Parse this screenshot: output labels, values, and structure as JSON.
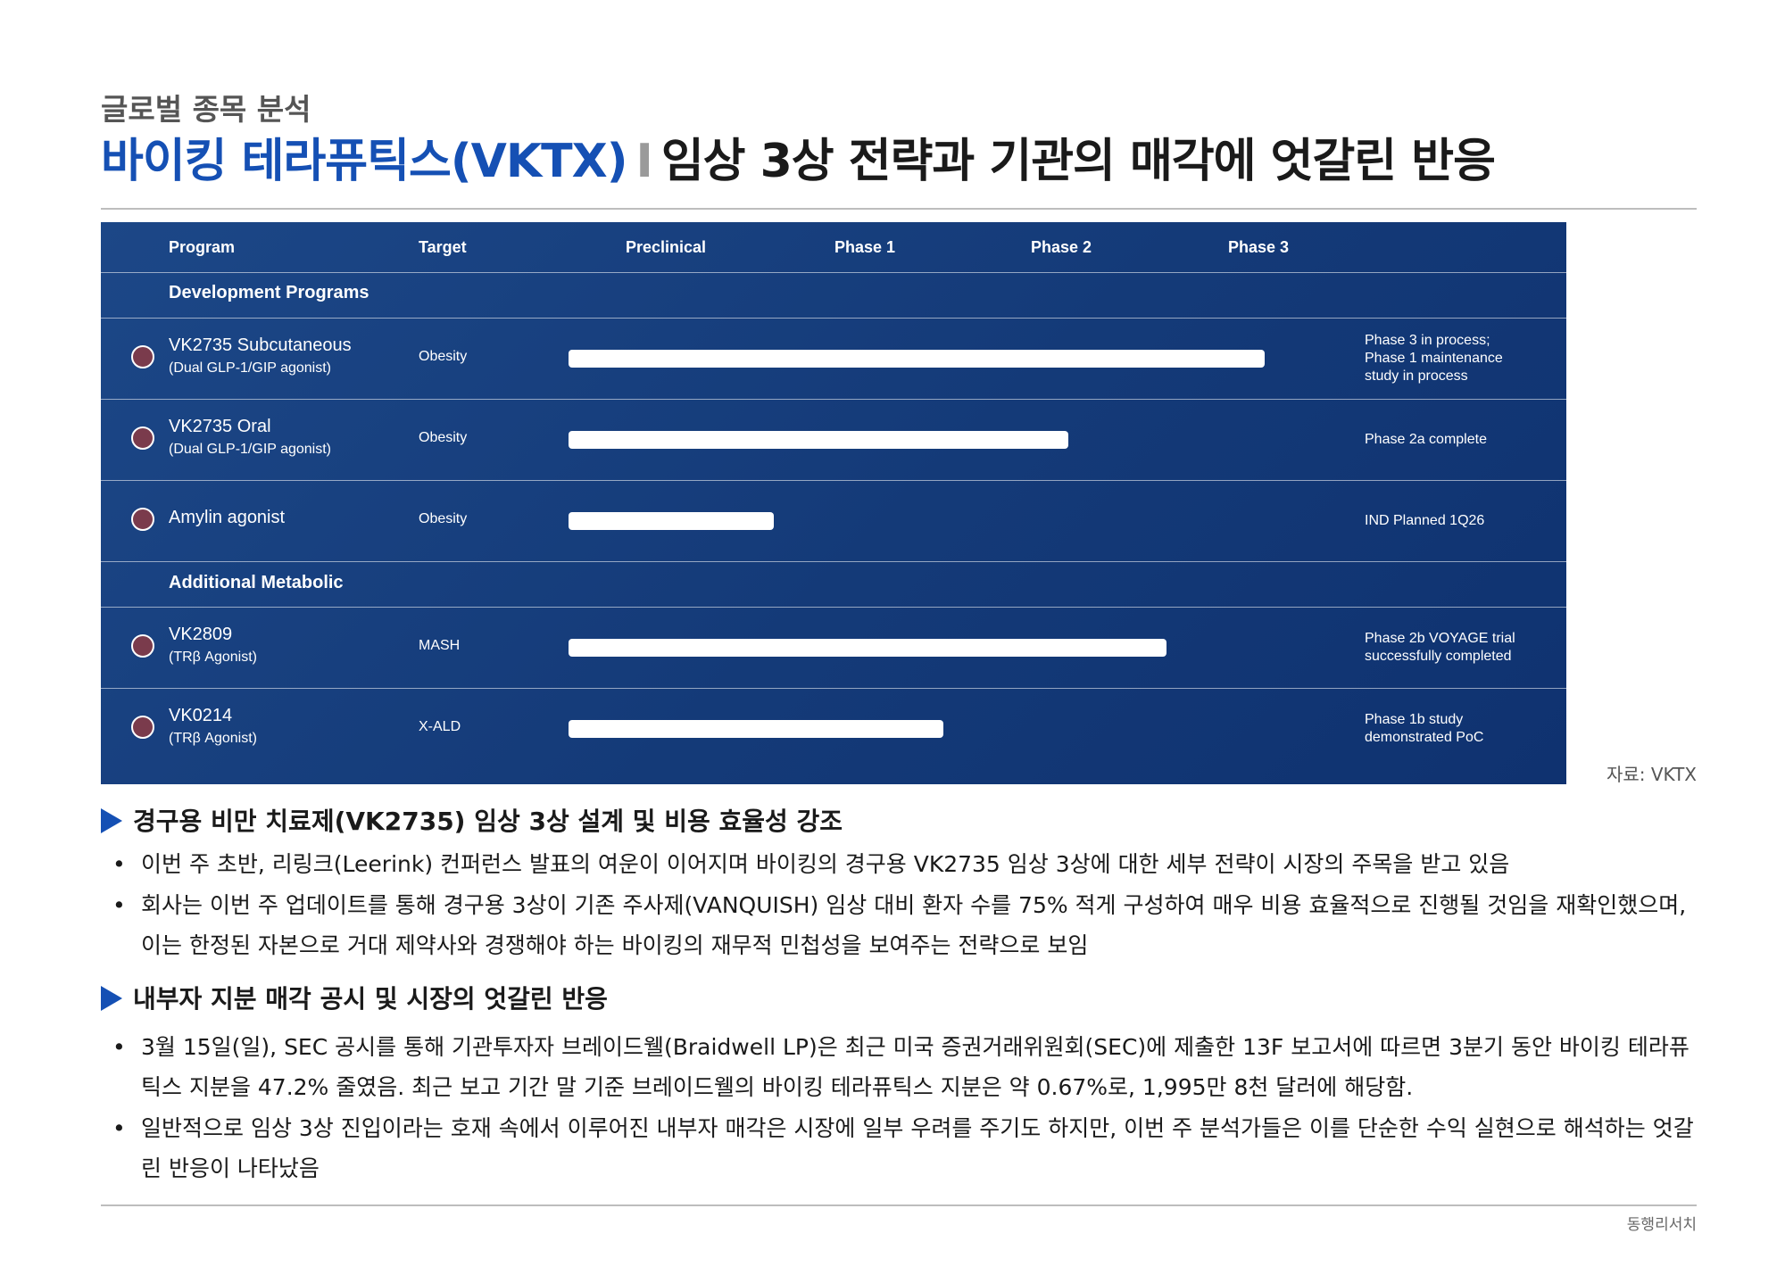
{
  "header": {
    "subtitle": "글로벌 종목 분석",
    "title_company": "바이킹 테라퓨틱스(VKTX)",
    "title_separator": "I",
    "title_topic": "임상 3상 전략과 기관의 매각에 엇갈린 반응"
  },
  "pipeline": {
    "columns": {
      "program": "Program",
      "target": "Target",
      "preclinical": "Preclinical",
      "phase1": "Phase 1",
      "phase2": "Phase 2",
      "phase3": "Phase 3"
    },
    "sections": [
      {
        "label": "Development Programs",
        "rows": [
          {
            "name": "VK2735 Subcutaneous",
            "sub": "(Dual GLP-1/GIP agonist)",
            "target": "Obesity",
            "progress": 0.78,
            "status": "Phase 3 in process;\nPhase 1 maintenance\nstudy in process"
          },
          {
            "name": "VK2735 Oral",
            "sub": "(Dual GLP-1/GIP agonist)",
            "target": "Obesity",
            "progress": 0.56,
            "status": "Phase 2a complete"
          },
          {
            "name": "Amylin agonist",
            "sub": "",
            "target": "Obesity",
            "progress": 0.23,
            "status": "IND Planned 1Q26"
          }
        ]
      },
      {
        "label": "Additional Metabolic",
        "rows": [
          {
            "name": "VK2809",
            "sub": "(TRβ Agonist)",
            "target": "MASH",
            "progress": 0.67,
            "status": "Phase 2b VOYAGE trial\nsuccessfully completed"
          },
          {
            "name": "VK0214",
            "sub": "(TRβ Agonist)",
            "target": "X-ALD",
            "progress": 0.42,
            "status": "Phase 1b study\ndemonstrated PoC"
          }
        ]
      }
    ],
    "source": "자료: VKTX"
  },
  "body": {
    "section1": {
      "heading": "경구용 비만 치료제(VK2735) 임상 3상 설계 및 비용 효율성 강조",
      "bullets": [
        "이번 주 초반, 리링크(Leerink) 컨퍼런스 발표의 여운이 이어지며 바이킹의 경구용 VK2735 임상 3상에 대한 세부 전략이 시장의 주목을 받고 있음",
        "회사는 이번 주 업데이트를 통해 경구용 3상이 기존 주사제(VANQUISH) 임상 대비 환자 수를 75% 적게 구성하여 매우 비용 효율적으로 진행될 것임을 재확인했으며, 이는 한정된 자본으로 거대 제약사와 경쟁해야 하는 바이킹의 재무적 민첩성을 보여주는 전략으로 보임"
      ]
    },
    "section2": {
      "heading": "내부자 지분 매각 공시 및 시장의 엇갈린 반응",
      "bullets": [
        "3월 15일(일), SEC 공시를 통해 기관투자자 브레이드웰(Braidwell LP)은 최근 미국 증권거래위원회(SEC)에 제출한 13F 보고서에 따르면 3분기 동안 바이킹 테라퓨틱스 지분을 47.2% 줄였음. 최근 보고 기간 말 기준 브레이드웰의 바이킹 테라퓨틱스 지분은 약 0.67%로, 1,995만 8천 달러에 해당함.",
        "일반적으로 임상 3상 진입이라는 호재 속에서 이루어진 내부자 매각은 시장에 일부 우려를 주기도 하지만, 이번 주 분석가들은 이를 단순한 수익 실현으로 해석하는 엇갈린 반응이 나타났음"
      ]
    }
  },
  "footer": {
    "brand": "동행리서치"
  },
  "colors": {
    "title_blue": "#1550b4",
    "panel_navy": "#143a78",
    "dot_maroon": "#7a3b4c"
  }
}
